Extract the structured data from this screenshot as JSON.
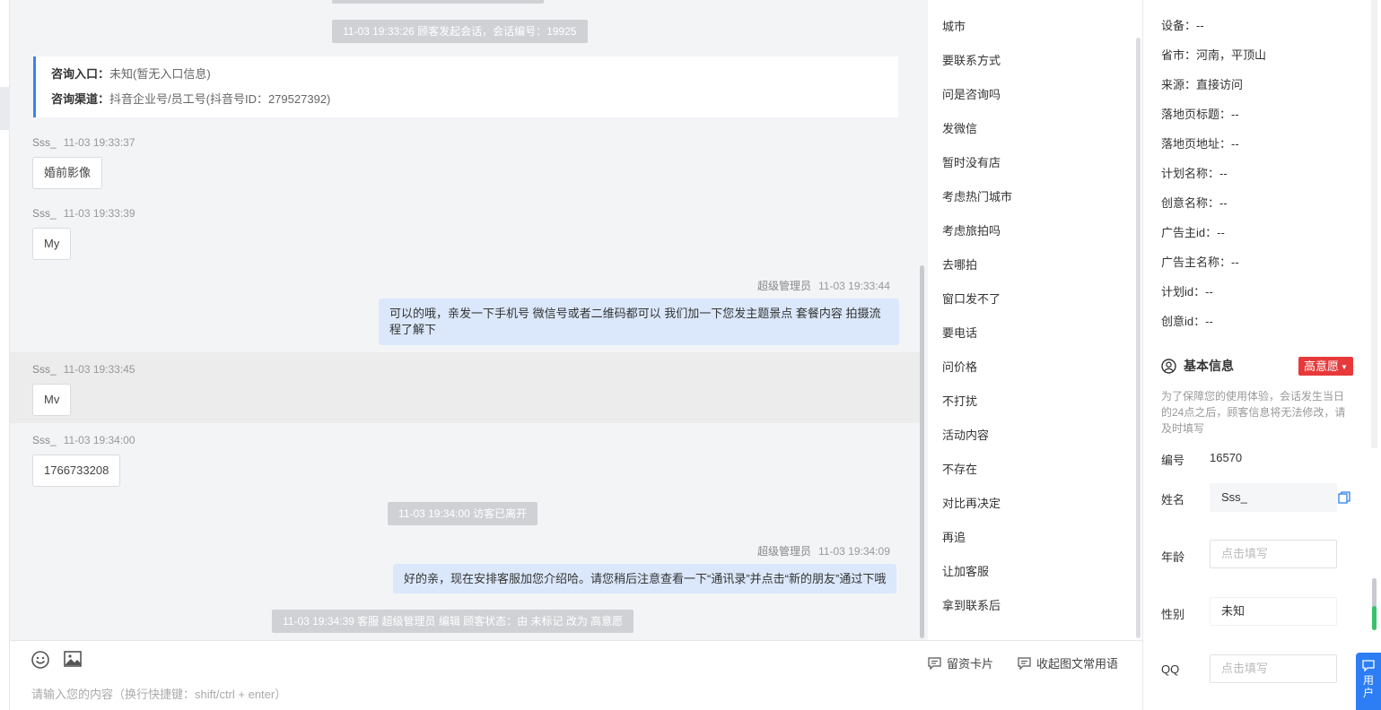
{
  "chat": {
    "top_system": "11-03 19:33:26 顾客发起会话，会话编号：19925",
    "info": {
      "entry_label": "咨询入口：",
      "entry_value": "未知(暂无入口信息)",
      "channel_label": "咨询渠道：",
      "channel_value": "抖音企业号/员工号(抖音号ID：279527392)"
    },
    "messages": [
      {
        "name": "Sss_",
        "time": "11-03 19:33:37",
        "text": "婚前影像"
      },
      {
        "name": "Sss_",
        "time": "11-03 19:33:39",
        "text": "My"
      },
      {
        "name": "超级管理员",
        "time": "11-03 19:33:44",
        "text": "可以的哦，亲发一下手机号 微信号或者二维码都可以 我们加一下您发主题景点 套餐内容 拍摄流程了解下"
      },
      {
        "name": "Sss_",
        "time": "11-03 19:33:45",
        "text": "Mv"
      },
      {
        "name": "Sss_",
        "time": "11-03 19:34:00",
        "text": "1766733208"
      },
      {
        "name": "超级管理员",
        "time": "11-03 19:34:09",
        "text": "好的亲，现在安排客服加您介绍哈。请您稍后注意查看一下“通讯录”并点击“新的朋友”通过下哦"
      }
    ],
    "left_system": "11-03 19:34:00 访客已离开",
    "status_system": "11-03 19:34:39 客服 超级管理员 编辑 顾客状态：由 未标记 改为 高意愿"
  },
  "quick_replies": [
    "城市",
    "要联系方式",
    "问是咨询吗",
    "发微信",
    "暂时没有店",
    "考虑热门城市",
    "考虑旅拍吗",
    "去哪拍",
    "窗口发不了",
    "要电话",
    "问价格",
    "不打扰",
    "活动内容",
    "不存在",
    "对比再决定",
    "再追",
    "让加客服",
    "拿到联系后"
  ],
  "input": {
    "placeholder": "请输入您的内容（换行快捷键：shift/ctrl + enter）",
    "card_label": "留资卡片",
    "phrases_label": "收起图文常用语"
  },
  "visitor": {
    "kv": [
      "设备：--",
      "省市：河南，平顶山",
      "来源：直接访问",
      "落地页标题：--",
      "落地页地址：--",
      "计划名称：--",
      "创意名称：--",
      "广告主id：--",
      "广告主名称：--",
      "计划id：--",
      "创意id：--"
    ],
    "basic_title": "基本信息",
    "intent_tag": "高意愿",
    "note": "为了保障您的使用体验，会话发生当日的24点之后，顾客信息将无法修改，请及时填写",
    "id_label": "编号",
    "id_value": "16570",
    "name_label": "姓名",
    "name_value": "Sss_",
    "age_label": "年龄",
    "age_placeholder": "点击填写",
    "gender_label": "性别",
    "gender_value": "未知",
    "qq_label": "QQ",
    "qq_placeholder": "点击填写"
  },
  "float_button": {
    "line1": "用",
    "line2": "户"
  },
  "colors": {
    "accent": "#3b82f6",
    "tag_red": "#e7393a",
    "bubble_blue": "#dbe8fb"
  }
}
